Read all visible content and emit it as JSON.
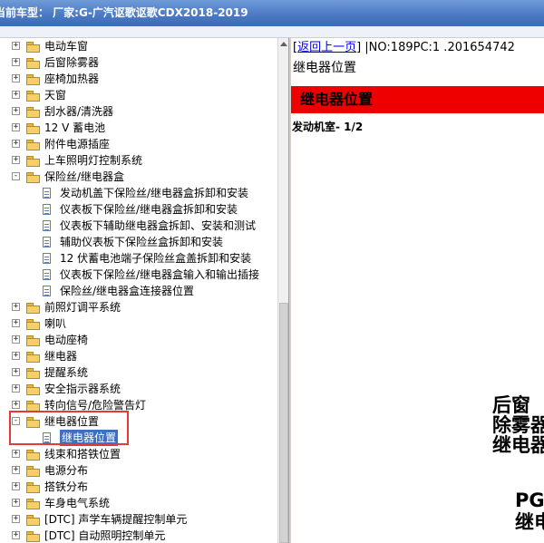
{
  "window": {
    "title": "当前车型： 厂家:G-广汽讴歌讴歌CDX2018-2019"
  },
  "tree": {
    "items": [
      {
        "label": "电动车窗",
        "expander": "+"
      },
      {
        "label": "后窗除雾器",
        "expander": "+"
      },
      {
        "label": "座椅加热器",
        "expander": "+"
      },
      {
        "label": "天窗",
        "expander": "+"
      },
      {
        "label": "刮水器/清洗器",
        "expander": "+"
      },
      {
        "label": "12 V 蓄电池",
        "expander": "+"
      },
      {
        "label": "附件电源插座",
        "expander": "+"
      },
      {
        "label": "上车照明灯控制系统",
        "expander": "+"
      },
      {
        "label": "保险丝/继电器盒",
        "expander": "-"
      },
      {
        "label": "发动机盖下保险丝/继电器盒拆卸和安装",
        "child": true
      },
      {
        "label": "仪表板下保险丝/继电器盒拆卸和安装",
        "child": true
      },
      {
        "label": "仪表板下辅助继电器盒拆卸、安装和测试",
        "child": true
      },
      {
        "label": "辅助仪表板下保险丝盒拆卸和安装",
        "child": true
      },
      {
        "label": "12 伏蓄电池端子保险丝盒盖拆卸和安装",
        "child": true
      },
      {
        "label": "仪表板下保险丝/继电器盒输入和输出插接",
        "child": true
      },
      {
        "label": "保险丝/继电器盒连接器位置",
        "child": true
      },
      {
        "label": "前照灯调平系统",
        "expander": "+"
      },
      {
        "label": "喇叭",
        "expander": "+"
      },
      {
        "label": "电动座椅",
        "expander": "+"
      },
      {
        "label": "继电器",
        "expander": "+"
      },
      {
        "label": "提醒系统",
        "expander": "+"
      },
      {
        "label": "安全指示器系统",
        "expander": "+"
      },
      {
        "label": "转向信号/危险警告灯",
        "expander": "+"
      },
      {
        "label": "继电器位置",
        "expander": "-"
      },
      {
        "label": "继电器位置",
        "child": true,
        "selected": true
      },
      {
        "label": "线束和搭铁位置",
        "expander": "+"
      },
      {
        "label": "电源分布",
        "expander": "+"
      },
      {
        "label": "搭铁分布",
        "expander": "+"
      },
      {
        "label": "车身电气系统",
        "expander": "+"
      },
      {
        "label": "[DTC] 声学车辆提醒控制单元",
        "expander": "+"
      },
      {
        "label": "[DTC] 自动照明控制单元",
        "expander": "+"
      }
    ]
  },
  "doc": {
    "back_link": "返回上一页",
    "nav_info": " |NO:189PC:1 .201654742",
    "title": "继电器位置",
    "banner": "继电器位置",
    "section": "发动机室- 1/2",
    "diagram_text_1": "后窗\n除雾器\n继电器",
    "diagram_text_2": "PG\n继电"
  }
}
